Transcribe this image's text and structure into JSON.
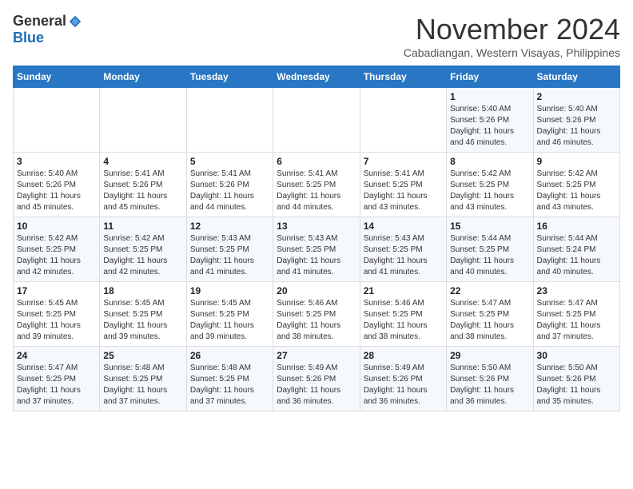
{
  "logo": {
    "general": "General",
    "blue": "Blue"
  },
  "title": "November 2024",
  "location": "Cabadiangan, Western Visayas, Philippines",
  "days_of_week": [
    "Sunday",
    "Monday",
    "Tuesday",
    "Wednesday",
    "Thursday",
    "Friday",
    "Saturday"
  ],
  "weeks": [
    [
      {
        "day": "",
        "info": ""
      },
      {
        "day": "",
        "info": ""
      },
      {
        "day": "",
        "info": ""
      },
      {
        "day": "",
        "info": ""
      },
      {
        "day": "",
        "info": ""
      },
      {
        "day": "1",
        "info": "Sunrise: 5:40 AM\nSunset: 5:26 PM\nDaylight: 11 hours\nand 46 minutes."
      },
      {
        "day": "2",
        "info": "Sunrise: 5:40 AM\nSunset: 5:26 PM\nDaylight: 11 hours\nand 46 minutes."
      }
    ],
    [
      {
        "day": "3",
        "info": "Sunrise: 5:40 AM\nSunset: 5:26 PM\nDaylight: 11 hours\nand 45 minutes."
      },
      {
        "day": "4",
        "info": "Sunrise: 5:41 AM\nSunset: 5:26 PM\nDaylight: 11 hours\nand 45 minutes."
      },
      {
        "day": "5",
        "info": "Sunrise: 5:41 AM\nSunset: 5:26 PM\nDaylight: 11 hours\nand 44 minutes."
      },
      {
        "day": "6",
        "info": "Sunrise: 5:41 AM\nSunset: 5:25 PM\nDaylight: 11 hours\nand 44 minutes."
      },
      {
        "day": "7",
        "info": "Sunrise: 5:41 AM\nSunset: 5:25 PM\nDaylight: 11 hours\nand 43 minutes."
      },
      {
        "day": "8",
        "info": "Sunrise: 5:42 AM\nSunset: 5:25 PM\nDaylight: 11 hours\nand 43 minutes."
      },
      {
        "day": "9",
        "info": "Sunrise: 5:42 AM\nSunset: 5:25 PM\nDaylight: 11 hours\nand 43 minutes."
      }
    ],
    [
      {
        "day": "10",
        "info": "Sunrise: 5:42 AM\nSunset: 5:25 PM\nDaylight: 11 hours\nand 42 minutes."
      },
      {
        "day": "11",
        "info": "Sunrise: 5:42 AM\nSunset: 5:25 PM\nDaylight: 11 hours\nand 42 minutes."
      },
      {
        "day": "12",
        "info": "Sunrise: 5:43 AM\nSunset: 5:25 PM\nDaylight: 11 hours\nand 41 minutes."
      },
      {
        "day": "13",
        "info": "Sunrise: 5:43 AM\nSunset: 5:25 PM\nDaylight: 11 hours\nand 41 minutes."
      },
      {
        "day": "14",
        "info": "Sunrise: 5:43 AM\nSunset: 5:25 PM\nDaylight: 11 hours\nand 41 minutes."
      },
      {
        "day": "15",
        "info": "Sunrise: 5:44 AM\nSunset: 5:25 PM\nDaylight: 11 hours\nand 40 minutes."
      },
      {
        "day": "16",
        "info": "Sunrise: 5:44 AM\nSunset: 5:24 PM\nDaylight: 11 hours\nand 40 minutes."
      }
    ],
    [
      {
        "day": "17",
        "info": "Sunrise: 5:45 AM\nSunset: 5:25 PM\nDaylight: 11 hours\nand 39 minutes."
      },
      {
        "day": "18",
        "info": "Sunrise: 5:45 AM\nSunset: 5:25 PM\nDaylight: 11 hours\nand 39 minutes."
      },
      {
        "day": "19",
        "info": "Sunrise: 5:45 AM\nSunset: 5:25 PM\nDaylight: 11 hours\nand 39 minutes."
      },
      {
        "day": "20",
        "info": "Sunrise: 5:46 AM\nSunset: 5:25 PM\nDaylight: 11 hours\nand 38 minutes."
      },
      {
        "day": "21",
        "info": "Sunrise: 5:46 AM\nSunset: 5:25 PM\nDaylight: 11 hours\nand 38 minutes."
      },
      {
        "day": "22",
        "info": "Sunrise: 5:47 AM\nSunset: 5:25 PM\nDaylight: 11 hours\nand 38 minutes."
      },
      {
        "day": "23",
        "info": "Sunrise: 5:47 AM\nSunset: 5:25 PM\nDaylight: 11 hours\nand 37 minutes."
      }
    ],
    [
      {
        "day": "24",
        "info": "Sunrise: 5:47 AM\nSunset: 5:25 PM\nDaylight: 11 hours\nand 37 minutes."
      },
      {
        "day": "25",
        "info": "Sunrise: 5:48 AM\nSunset: 5:25 PM\nDaylight: 11 hours\nand 37 minutes."
      },
      {
        "day": "26",
        "info": "Sunrise: 5:48 AM\nSunset: 5:25 PM\nDaylight: 11 hours\nand 37 minutes."
      },
      {
        "day": "27",
        "info": "Sunrise: 5:49 AM\nSunset: 5:26 PM\nDaylight: 11 hours\nand 36 minutes."
      },
      {
        "day": "28",
        "info": "Sunrise: 5:49 AM\nSunset: 5:26 PM\nDaylight: 11 hours\nand 36 minutes."
      },
      {
        "day": "29",
        "info": "Sunrise: 5:50 AM\nSunset: 5:26 PM\nDaylight: 11 hours\nand 36 minutes."
      },
      {
        "day": "30",
        "info": "Sunrise: 5:50 AM\nSunset: 5:26 PM\nDaylight: 11 hours\nand 35 minutes."
      }
    ]
  ]
}
